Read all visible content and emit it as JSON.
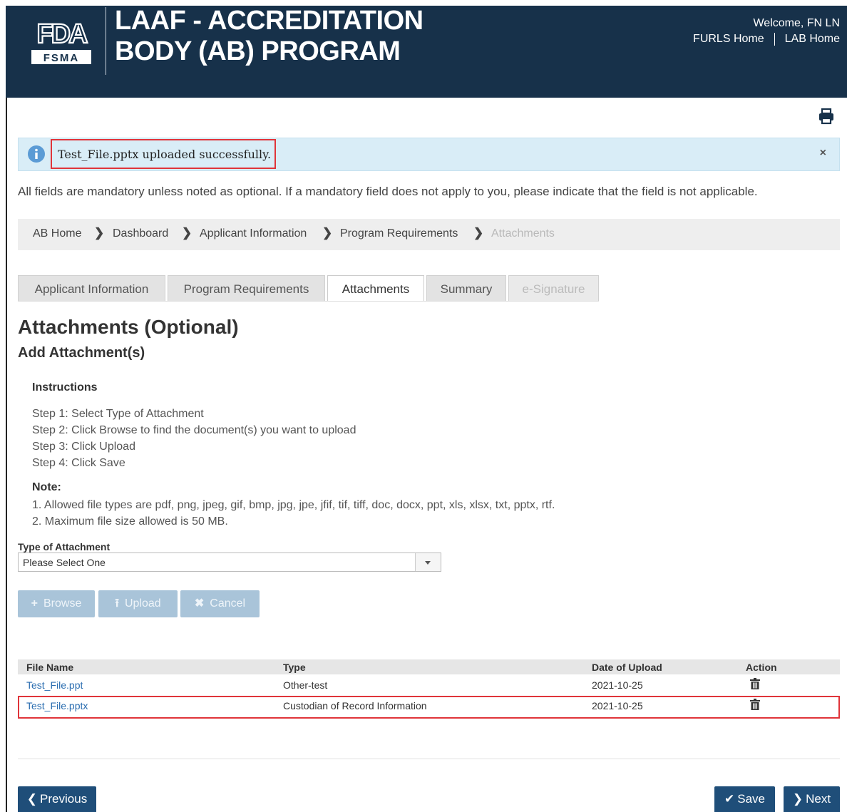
{
  "header": {
    "logo_top": "FDA",
    "logo_bottom": "FSMA",
    "title_line1": "LAAF - ACCREDITATION",
    "title_line2": "BODY (AB) PROGRAM",
    "welcome": "Welcome, FN LN",
    "links": [
      "FURLS Home",
      "LAB Home"
    ]
  },
  "alert": {
    "message": "Test_File.pptx uploaded successfully.",
    "close": "×"
  },
  "mandatory_note": "All fields are mandatory unless noted as optional. If a mandatory field does not apply to you, please indicate that the field is not applicable.",
  "breadcrumb": [
    "AB Home",
    "Dashboard",
    "Applicant Information",
    "Program Requirements",
    "Attachments"
  ],
  "tabs": [
    {
      "label": "Applicant Information",
      "state": "normal"
    },
    {
      "label": "Program Requirements",
      "state": "normal"
    },
    {
      "label": "Attachments",
      "state": "active"
    },
    {
      "label": "Summary",
      "state": "normal"
    },
    {
      "label": "e-Signature",
      "state": "disabled"
    }
  ],
  "page_title": "Attachments (Optional)",
  "subtitle": "Add Attachment(s)",
  "instructions": {
    "title": "Instructions",
    "steps": [
      "Step 1: Select Type of Attachment",
      "Step 2: Click Browse to find the document(s) you want to upload",
      "Step 3: Click Upload",
      "Step 4: Click Save"
    ]
  },
  "note": {
    "title": "Note:",
    "items": [
      "1. Allowed file types are pdf, png, jpeg, gif, bmp, jpg, jpe, jfif, tif, tiff, doc, docx, ppt, xls, xlsx, txt, pptx, rtf.",
      "2. Maximum file size allowed is 50 MB."
    ]
  },
  "type_field": {
    "label": "Type of Attachment",
    "value": "Please Select One"
  },
  "upload_buttons": {
    "browse": "Browse",
    "upload": "Upload",
    "cancel": "Cancel"
  },
  "table": {
    "headers": [
      "File Name",
      "Type",
      "Date of Upload",
      "Action"
    ],
    "rows": [
      {
        "file": "Test_File.ppt",
        "type": "Other-test",
        "date": "2021-10-25"
      },
      {
        "file": "Test_File.pptx",
        "type": "Custodian of Record Information",
        "date": "2021-10-25"
      }
    ]
  },
  "footer_buttons": {
    "previous": "Previous",
    "save": "Save",
    "next": "Next"
  },
  "colors": {
    "header_bg": "#17314a",
    "primary_button": "#1f4e79",
    "disabled_button": "#a9c4d9",
    "alert_bg": "#d9edf7",
    "highlight": "#e0343a"
  }
}
